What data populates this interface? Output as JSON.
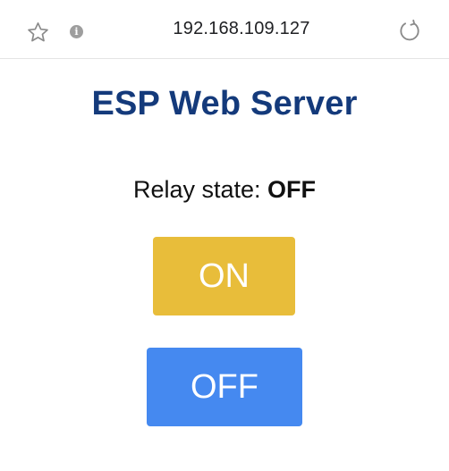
{
  "browser": {
    "url": "192.168.109.127",
    "icons": {
      "bookmark": "star-icon",
      "site_info": "info-icon",
      "reload": "reload-icon"
    },
    "info_glyph": "i"
  },
  "main": {
    "title": "ESP Web Server",
    "relay_label": "Relay state: ",
    "relay_value": "OFF",
    "buttons": {
      "on_label": "ON",
      "off_label": "OFF"
    }
  },
  "colors": {
    "title": "#143a7b",
    "on_button": "#e8bd3a",
    "off_button": "#4589f0",
    "button_text": "#ffffff"
  }
}
